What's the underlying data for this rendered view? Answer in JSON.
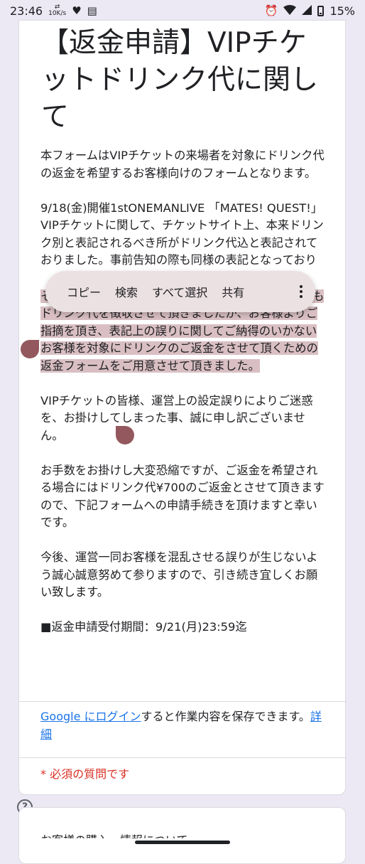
{
  "status_bar": {
    "time": "23:46",
    "data_speed": "10K/s",
    "battery_percent": "15%",
    "icons": [
      "data-speed-icon",
      "heart-icon",
      "news-icon",
      "alarm-icon",
      "wifi-icon",
      "signal-icon",
      "battery-icon"
    ]
  },
  "form": {
    "title": "【返金申請】VIPチケットドリンク代に関して",
    "paragraphs": [
      "本フォームはVIPチケットの来場者を対象にドリンク代の返金を希望するお客様向けのフォームとなります。",
      "9/18(金)開催1stONEMANLIVE 「MATES! QUEST!」 VIPチケットに関して、チケットサイト上、本来ドリンク別と表記されるべき所がドリンク代込と表記されておりました。事前告知の際も同様の表記となっておりました。",
      "その為、会場運用としてはVIPチケットのお客様からもドリンク代を徴収させて頂きましたが、お客様よりご指摘を頂き、表記上の誤りに関してご納得のいかないお客様を対象にドリンクのご返金をさせて頂くための返金フォームをご用意させて頂きました。",
      "VIPチケットの皆様、運営上の設定誤りによりご迷惑を、お掛けしてしまった事、誠に申し訳ございません。",
      "お手数をお掛けし大変恐縮ですが、ご返金を希望される場合にはドリンク代¥700のご返金とさせて頂きますので、下記フォームへの申請手続きを頂けますと幸いです。",
      "今後、運営一同お客様を混乱させる誤りが生じないよう誠心誠意努めて参りますので、引き続き宜しくお願い致します。",
      "■返金申請受付期間：9/21(月)23:59迄"
    ],
    "login_link": "Google にログイン",
    "login_text": "すると作業内容を保存できます。",
    "details_link": "詳細",
    "required_note": "* 必須の質問です",
    "next_section_text": "お客様の購入・情報について"
  },
  "selection_toolbar": {
    "items": [
      "コピー",
      "検索",
      "すべて選択",
      "共有"
    ],
    "more_icon": "more-vert-icon"
  },
  "colors": {
    "selection": "#d9bfc3",
    "handle": "#93585d",
    "toolbar_bg": "#ece1e2",
    "link": "#1a73e8",
    "required": "#d93025",
    "page_bg": "#ece8f4"
  }
}
